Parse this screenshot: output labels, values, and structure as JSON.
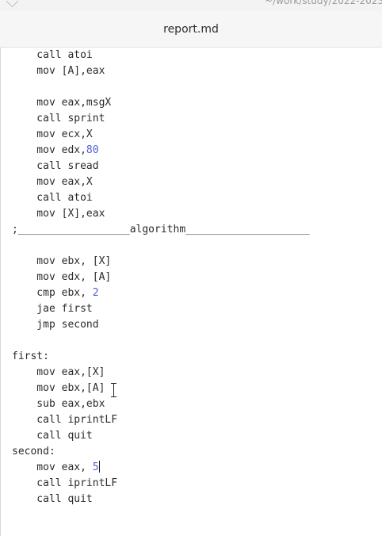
{
  "window": {
    "path_fragment": "~/work/study/2022-2023",
    "title": "report.md"
  },
  "editor": {
    "lines": [
      {
        "id": "l1",
        "pre": "    call atoi",
        "num": "",
        "post": ""
      },
      {
        "id": "l2",
        "pre": "    mov [A],eax",
        "num": "",
        "post": ""
      },
      {
        "id": "l3",
        "pre": "",
        "num": "",
        "post": ""
      },
      {
        "id": "l4",
        "pre": "    mov eax,msgX",
        "num": "",
        "post": ""
      },
      {
        "id": "l5",
        "pre": "    call sprint",
        "num": "",
        "post": ""
      },
      {
        "id": "l6",
        "pre": "    mov ecx,X",
        "num": "",
        "post": ""
      },
      {
        "id": "l7",
        "pre": "    mov edx,",
        "num": "80",
        "post": ""
      },
      {
        "id": "l8",
        "pre": "    call sread",
        "num": "",
        "post": ""
      },
      {
        "id": "l9",
        "pre": "    mov eax,X",
        "num": "",
        "post": ""
      },
      {
        "id": "l10",
        "pre": "    call atoi",
        "num": "",
        "post": ""
      },
      {
        "id": "l11",
        "pre": "    mov [X],eax",
        "num": "",
        "post": ""
      },
      {
        "id": "l12",
        "pre": ";__________________algorithm____________________",
        "num": "",
        "post": ""
      },
      {
        "id": "l13",
        "pre": "",
        "num": "",
        "post": ""
      },
      {
        "id": "l14",
        "pre": "    mov ebx, [X]",
        "num": "",
        "post": ""
      },
      {
        "id": "l15",
        "pre": "    mov edx, [A]",
        "num": "",
        "post": ""
      },
      {
        "id": "l16",
        "pre": "    cmp ebx, ",
        "num": "2",
        "post": ""
      },
      {
        "id": "l17",
        "pre": "    jae first",
        "num": "",
        "post": ""
      },
      {
        "id": "l18",
        "pre": "    jmp second",
        "num": "",
        "post": ""
      },
      {
        "id": "l19",
        "pre": "",
        "num": "",
        "post": ""
      },
      {
        "id": "l20",
        "pre": "first:",
        "num": "",
        "post": ""
      },
      {
        "id": "l21",
        "pre": "    mov eax,[X]",
        "num": "",
        "post": ""
      },
      {
        "id": "l22",
        "pre": "    mov ebx,[A]",
        "num": "",
        "post": ""
      },
      {
        "id": "l23",
        "pre": "    sub eax,ebx",
        "num": "",
        "post": ""
      },
      {
        "id": "l24",
        "pre": "    call iprintLF",
        "num": "",
        "post": ""
      },
      {
        "id": "l25",
        "pre": "    call quit",
        "num": "",
        "post": ""
      },
      {
        "id": "l26",
        "pre": "second:",
        "num": "",
        "post": ""
      },
      {
        "id": "l27",
        "pre": "    mov eax, ",
        "num": "5",
        "post": "",
        "caret": true
      },
      {
        "id": "l28",
        "pre": "    call iprintLF",
        "num": "",
        "post": ""
      },
      {
        "id": "l29",
        "pre": "    call quit",
        "num": "",
        "post": ""
      }
    ]
  },
  "colors": {
    "number": "#4c5fd5",
    "text": "#2b2b2b",
    "titlebar": "#f6f6f6"
  }
}
